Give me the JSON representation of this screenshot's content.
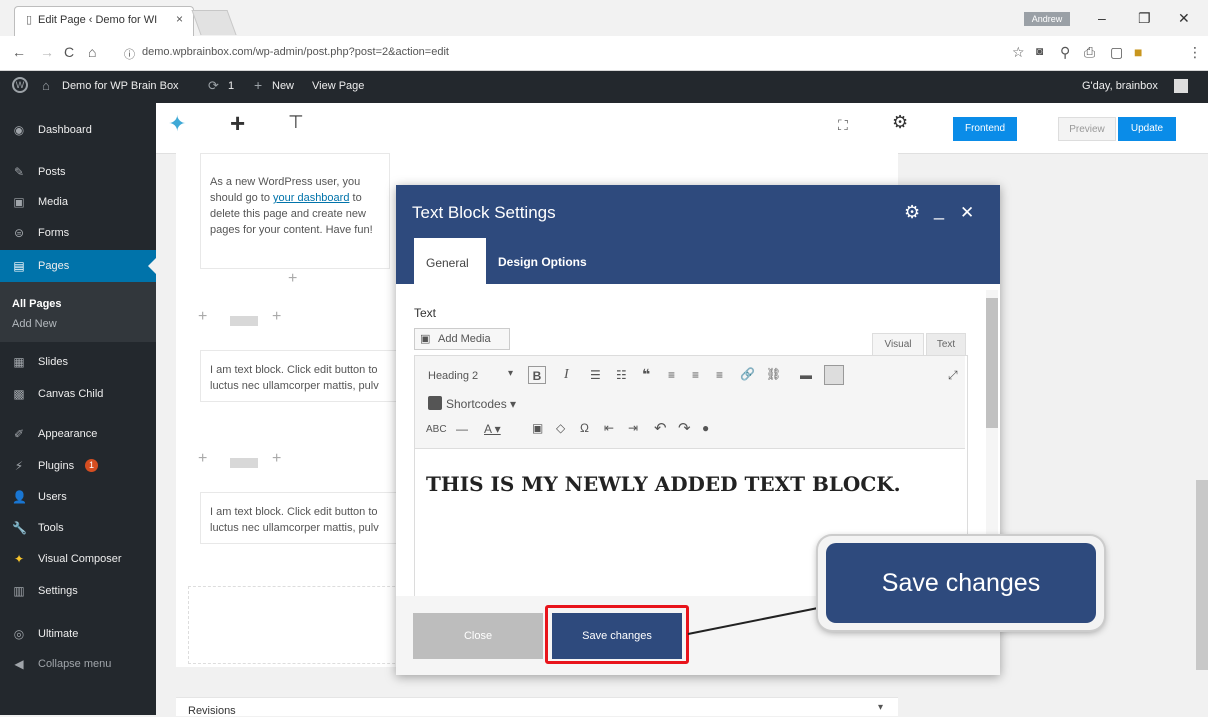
{
  "browser": {
    "tab_title": "Edit Page ‹ Demo for WI",
    "tab_close": "×",
    "profile": "Andrew",
    "url": "demo.wpbrainbox.com/wp-admin/post.php?post=2&action=edit"
  },
  "adminbar": {
    "site": "Demo for WP Brain Box",
    "updates": "1",
    "new": "New",
    "view": "View Page",
    "greeting": "G'day, brainbox"
  },
  "sidebar": {
    "items": [
      {
        "label": "Dashboard",
        "icon": "dashboard-icon"
      },
      {
        "label": "Posts",
        "icon": "pin-icon"
      },
      {
        "label": "Media",
        "icon": "media-icon"
      },
      {
        "label": "Forms",
        "icon": "forms-icon"
      },
      {
        "label": "Pages",
        "icon": "pages-icon"
      },
      {
        "label": "Slides",
        "icon": "slides-icon"
      },
      {
        "label": "Canvas Child",
        "icon": "canvas-icon"
      },
      {
        "label": "Appearance",
        "icon": "brush-icon"
      },
      {
        "label": "Plugins",
        "icon": "plugin-icon"
      },
      {
        "label": "Users",
        "icon": "users-icon"
      },
      {
        "label": "Tools",
        "icon": "wrench-icon"
      },
      {
        "label": "Visual Composer",
        "icon": "vc-icon"
      },
      {
        "label": "Settings",
        "icon": "settings-icon"
      },
      {
        "label": "Ultimate",
        "icon": "ultimate-icon"
      },
      {
        "label": "Collapse menu",
        "icon": "collapse-icon"
      }
    ],
    "sub_all": "All Pages",
    "sub_add": "Add New",
    "plugins_badge": "1"
  },
  "toolbar": {
    "frontend": "Frontend",
    "preview": "Preview",
    "update": "Update"
  },
  "canvas": {
    "block1": "As a new WordPress user, you should go to",
    "block1_link": "your dashboard",
    "block1_rest": "to delete this page and create new pages for your content. Have fun!",
    "block2": "I am text block. Click edit button to",
    "block2b": "luctus nec ullamcorper mattis, pulv",
    "block3": "I am text block. Click edit button to",
    "block3b": "luctus nec ullamcorper mattis, pulv",
    "revisions": "Revisions"
  },
  "modal": {
    "title": "Text Block Settings",
    "tab_general": "General",
    "tab_design": "Design Options",
    "text_label": "Text",
    "add_media": "Add Media",
    "tab_visual": "Visual",
    "tab_text": "Text",
    "format": "Heading 2",
    "shortcodes": "Shortcodes ▾",
    "content": "THIS IS MY NEWLY ADDED TEXT BLOCK.",
    "close": "Close",
    "save": "Save changes"
  },
  "callout": "Save changes",
  "colors": {
    "accent": "#2e4a7d",
    "wp_blue": "#0073aa",
    "highlight": "#e8141b"
  }
}
